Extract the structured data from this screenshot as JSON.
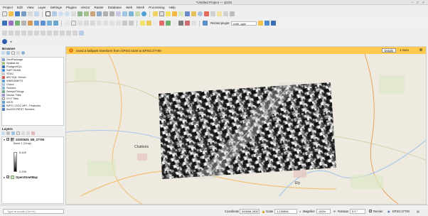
{
  "window": {
    "title": "*Untitled Project — QGIS"
  },
  "menu": [
    "Project",
    "Edit",
    "View",
    "Layer",
    "Settings",
    "Plugins",
    "Vector",
    "Raster",
    "Database",
    "Web",
    "Mesh",
    "Processing",
    "Help"
  ],
  "toolbar": {
    "plugin_reload_label": "Reload plugin:",
    "plugin_reload_value": "xodh_qgis"
  },
  "browser": {
    "title": "Browser",
    "items": [
      {
        "label": "GeoPackage",
        "icon": "geopackage-icon"
      },
      {
        "label": "SpatiaLite",
        "icon": "spatialite-icon"
      },
      {
        "label": "PostgreSQL",
        "icon": "postgresql-icon"
      },
      {
        "label": "SAP HANA",
        "icon": "sap-hana-icon"
      },
      {
        "label": "STAC",
        "icon": "stac-icon"
      },
      {
        "label": "MS SQL Server",
        "icon": "mssql-icon"
      },
      {
        "label": "WMS/WMTS",
        "icon": "wms-icon"
      },
      {
        "label": "Cloud",
        "icon": "cloud-icon"
      },
      {
        "label": "Scenes",
        "icon": "scenes-icon"
      },
      {
        "label": "SensorThings",
        "icon": "sensorthings-icon"
      },
      {
        "label": "Vector Tiles",
        "icon": "vector-tiles-icon"
      },
      {
        "label": "XYZ Tiles",
        "icon": "xyz-tiles-icon"
      },
      {
        "label": "WCS",
        "icon": "wcs-icon"
      },
      {
        "label": "WFS / OGC API - Features",
        "icon": "wfs-icon"
      },
      {
        "label": "ArcGIS REST Servers",
        "icon": "arcgis-icon"
      }
    ]
  },
  "layers": {
    "title": "Layers",
    "raster": {
      "name": "20200625_B8_27700",
      "band": "Band 1 (Gray)",
      "max": "6,420",
      "min": "2,239"
    },
    "basemap": {
      "name": "OpenStreetMap"
    }
  },
  "message_bar": {
    "text": "Used a ballpark transform from GPSG:4326 to EPSG:27700",
    "details_label": "Details",
    "more_label": "1 more"
  },
  "map": {
    "places": [
      "Chatteris",
      "Ely"
    ]
  },
  "status": {
    "locator_placeholder": "Type to locate (Ctrl+K)",
    "coordinate_label": "Coordinate",
    "coordinate_value": "545658,283079",
    "scale_label": "Scale",
    "scale_value": "1:130896",
    "magnifier_label": "Magnifier",
    "magnifier_value": "100%",
    "rotation_label": "Rotation",
    "rotation_value": "0.0 °",
    "render_label": "Render",
    "crs_label": "EPSG:27700"
  },
  "colors": {
    "message_bar": "#ffc94d",
    "map_background": "#eeeae0",
    "accent": "#e07b00"
  }
}
